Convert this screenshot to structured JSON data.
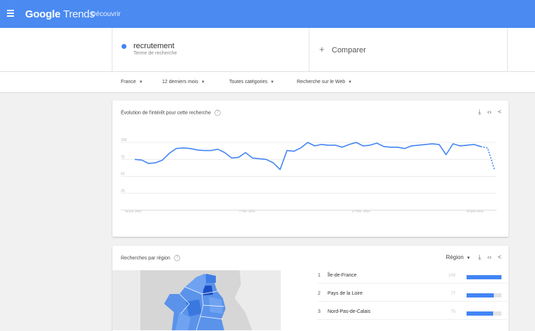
{
  "header": {
    "logo_main": "Google",
    "logo_sub": "Trends",
    "nav_label": "Découvrir"
  },
  "search": {
    "term": "recrutement",
    "term_type": "Terme de recherche",
    "compare_label": "Comparer"
  },
  "filters": [
    {
      "label": "France"
    },
    {
      "label": "12 derniers mois"
    },
    {
      "label": "Toutes catégories"
    },
    {
      "label": "Recherche sur le Web"
    }
  ],
  "interest_card": {
    "title": "Évolution de l'intérêt pour cette recherche"
  },
  "chart_data": {
    "type": "line",
    "y_ticks": [
      "100",
      "75",
      "50",
      "25"
    ],
    "ylim": [
      0,
      100
    ],
    "x_labels": [
      "18 juil. 2021",
      "7 nov. 2021",
      "27 févr. 2022",
      "19 juin 2022"
    ],
    "series": [
      {
        "values": [
          75,
          74,
          69,
          70,
          74,
          84,
          91,
          92,
          91,
          89,
          88,
          88,
          90,
          85,
          77,
          78,
          85,
          77,
          76,
          75,
          70,
          60,
          88,
          87,
          92,
          100,
          95,
          97,
          96,
          96,
          93,
          97,
          100,
          95,
          96,
          99,
          94,
          93,
          93,
          91,
          95,
          96,
          97,
          98,
          97,
          82,
          98,
          95,
          96,
          97,
          94,
          92,
          60
        ],
        "partial_from_index": 50
      }
    ],
    "grid": true,
    "line_color": "#4285f4"
  },
  "region_card": {
    "title": "Recherches par région",
    "region_select": "Région",
    "rows": [
      {
        "rank": "1",
        "name": "Île-de-France",
        "value": 100
      },
      {
        "rank": "2",
        "name": "Pays de la Loire",
        "value": 77
      },
      {
        "rank": "3",
        "name": "Nord-Pas-de-Calais",
        "value": 75
      }
    ]
  }
}
